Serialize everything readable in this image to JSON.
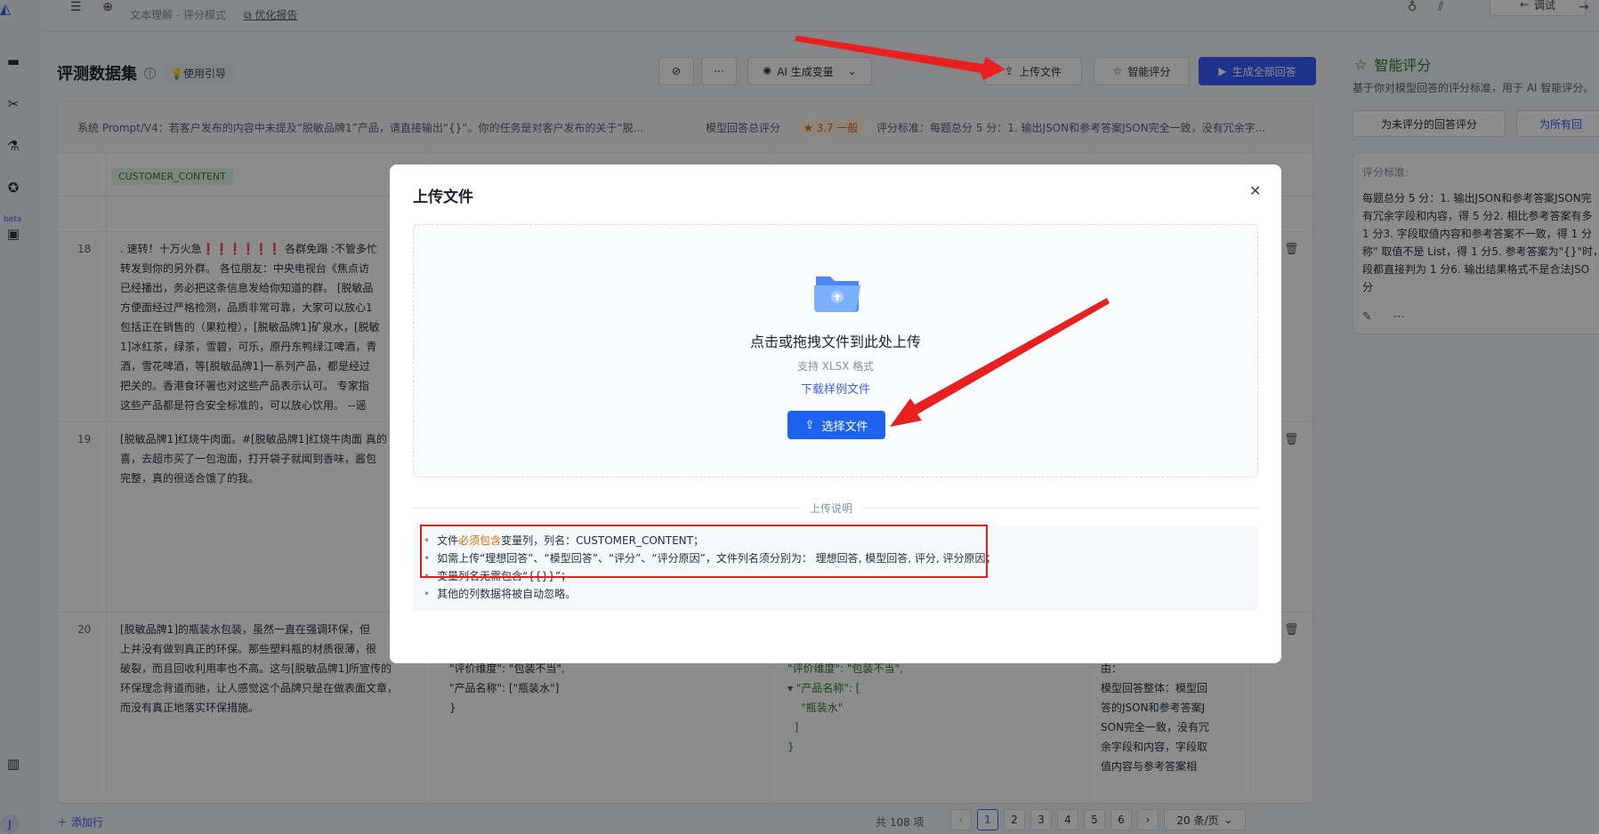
{
  "topbar": {
    "breadcrumb": "文本理解 - 评分模式",
    "optimize_report": "优化报告",
    "debug_label": "调试"
  },
  "rail": {
    "beta": "beta",
    "avatar": "J"
  },
  "main": {
    "title": "评测数据集",
    "guide": "使用引导",
    "toolbar": {
      "ai_generate": "AI 生成变量",
      "upload": "上传文件",
      "smart_score": "智能评分",
      "generate_all": "生成全部回答"
    },
    "system_prompt": "系统 Prompt/V4：若客户发布的内容中未提及“脱敏品牌1”产品，请直接输出“{}”。你的任务是对客户发布的关于“脱...",
    "score_label": "模型回答总评分",
    "score_value": "3.7 一般",
    "standard": "评分标准：每题总分 5 分：1. 输出JSON和参考答案JSON完全一致，没有冗余字...",
    "column_var": "CUSTOMER_CONTENT",
    "rows": [
      {
        "num": "18",
        "text": ". 速转！十万火急❗❗❗❗❗❗ 各群免蹋 :不管多忙\n转发到你的另外群。 各位朋友：中央电视台《焦点访\n已经播出，务必把这条信息发给你知道的群。 [脱敏品\n方便面经过严格检测，品质非常可靠，大家可以放心1\n包括正在销售的（果粒橙），[脱敏品牌1]矿泉水，[脱敏\n1]冰红茶，绿茶，雪碧，可乐，原丹东鸭绿江啤酒，青\n酒，雪花啤酒，等[脱敏品牌1]一系列产品，都是经过\n把关的。香港食环署也对这些产品表示认可。 专家指\n这些产品都是符合安全标准的，可以放心饮用。 --谣"
      },
      {
        "num": "19",
        "text": "[脱敏品牌1]红烧牛肉面。#[脱敏品牌1]红烧牛肉面 真的\n喜，去超市买了一包泡面，打开袋子就闻到香味，酱包\n完整，真的很适合饿了的我。"
      },
      {
        "num": "20",
        "text": "[脱敏品牌1]的瓶装水包装，虽然一直在强调环保，但\n上并没有做到真正的环保。那些塑料瓶的材质很薄，很\n破裂，而且回收利用率也不高。这与[脱敏品牌1]所宣传的\n环保理念背道而驰，让人感觉这个品牌只是在做表面文章，\n而没有真正地落实环保措施。",
        "ideal": "\"评价维度\": \"包装不当\",\n\"产品名称\": [\"瓶装水\"]\n}",
        "model": "\"评价维度\": \"包装不当\",\n▾ \"产品名称\": [\n    \"瓶装水\"\n  ]\n}",
        "reason": "以下为AI生成的评分理\n由：\n模型回答整体：模型回\n答的JSON和参考答案J\nSON完全一致，没有冗\n余字段和内容，字段取\n值内容与参考答案相"
      }
    ],
    "add_row": "添加行",
    "total": "共 108 项",
    "pages": [
      "1",
      "2",
      "3",
      "4",
      "5",
      "6"
    ],
    "page_size": "20 条/页"
  },
  "right_panel": {
    "title": "智能评分",
    "desc": "基于你对模型回答的评分标准，用于 AI 智能评分。",
    "btn_unscored": "为未评分的回答评分",
    "btn_all": "为所有回",
    "criteria_label": "评分标准:",
    "criteria_text": "每题总分 5 分：1. 输出JSON和参考答案JSON完\n有冗余字段和内容，得 5 分2. 相比参考答案有多\n1 分3. 字段取值内容和参考答案不一致，得 1 分\n称\" 取值不是 List，得 1 分5. 参考答案为\"{}\"时，\n段都直接判为 1 分6. 输出结果格式不是合法JSO\n分"
  },
  "modal": {
    "title": "上传文件",
    "drop_title": "点击或拖拽文件到此处上传",
    "support": "支持 XLSX 格式",
    "download_sample": "下载样例文件",
    "choose_file": "选择文件",
    "section_label": "上传说明",
    "notes": {
      "n1_pre": "文件",
      "n1_hl": "必须包含",
      "n1_post": "变量列，列名：CUSTOMER_CONTENT；",
      "n2": "如需上传“理想回答”、“模型回答”、“评分”、“评分原因”，文件列名须分别为： 理想回答, 模型回答, 评分, 评分原因；",
      "n3": "变量列名无需包含“{{}}”；",
      "n4": "其他的列数据将被自动忽略。"
    }
  }
}
